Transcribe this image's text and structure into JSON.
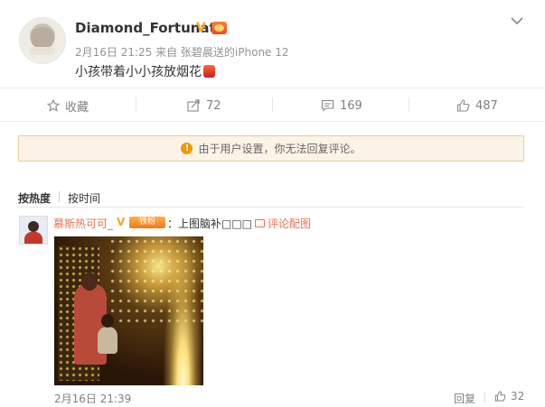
{
  "post": {
    "username": "Diamond_Fortunate",
    "verified_mark": "V",
    "meta": "2月16日 21:25 来自 张碧晨送的iPhone 12",
    "text": "小孩带着小小孩放烟花"
  },
  "actions": {
    "favorite_label": "收藏",
    "repost_count": "72",
    "comment_count": "169",
    "like_count": "487"
  },
  "notice": {
    "icon": "!",
    "text": "由于用户设置，你无法回复评论。"
  },
  "sort": {
    "by_hot": "按热度",
    "by_time": "按时间"
  },
  "comment": {
    "author": "慕斯热可可_",
    "verified_mark": "V",
    "badge": "铁粉",
    "text": "：上图脑补□□□",
    "pic_link": "评论配图",
    "time": "2月16日 21:39",
    "reply_label": "回复",
    "like_count": "32"
  },
  "colors": {
    "accent": "#eb7350",
    "verified": "#f6a623",
    "notice_bg": "#fcf3e7",
    "notice_border": "#f0c89a"
  }
}
